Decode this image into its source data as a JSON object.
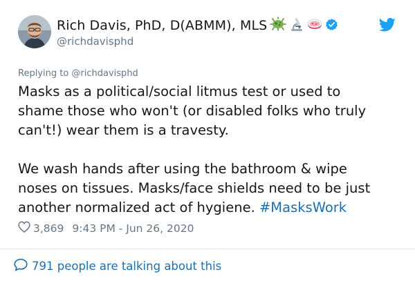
{
  "author": {
    "display_name": "Rich Davis, PhD, D(ABMM), MLS",
    "handle": "@richdavisphd",
    "name_emojis": [
      "microbe-icon",
      "microscope-icon",
      "petri-dish-icon"
    ],
    "verified": true
  },
  "reply": {
    "text": "Replying to @richdavisphd"
  },
  "tweet": {
    "lines": [
      "Masks as a political/social litmus test or used to",
      "shame those who won't (or disabled folks who truly",
      "can't!) wear them is a travesty.",
      "We wash hands after using the bathroom & wipe",
      "noses on tissues. Masks/face shields need to be just",
      "another normalized act of hygiene."
    ],
    "hashtag": "#MasksWork"
  },
  "meta": {
    "like_count": "3,869",
    "timestamp": "9:43 PM - Jun 26, 2020"
  },
  "footer": {
    "talking_text": "791 people are talking about this"
  },
  "colors": {
    "link": "#1b6fb0",
    "muted": "#657786",
    "text": "#14171a",
    "twitter_blue": "#1da1f2"
  }
}
